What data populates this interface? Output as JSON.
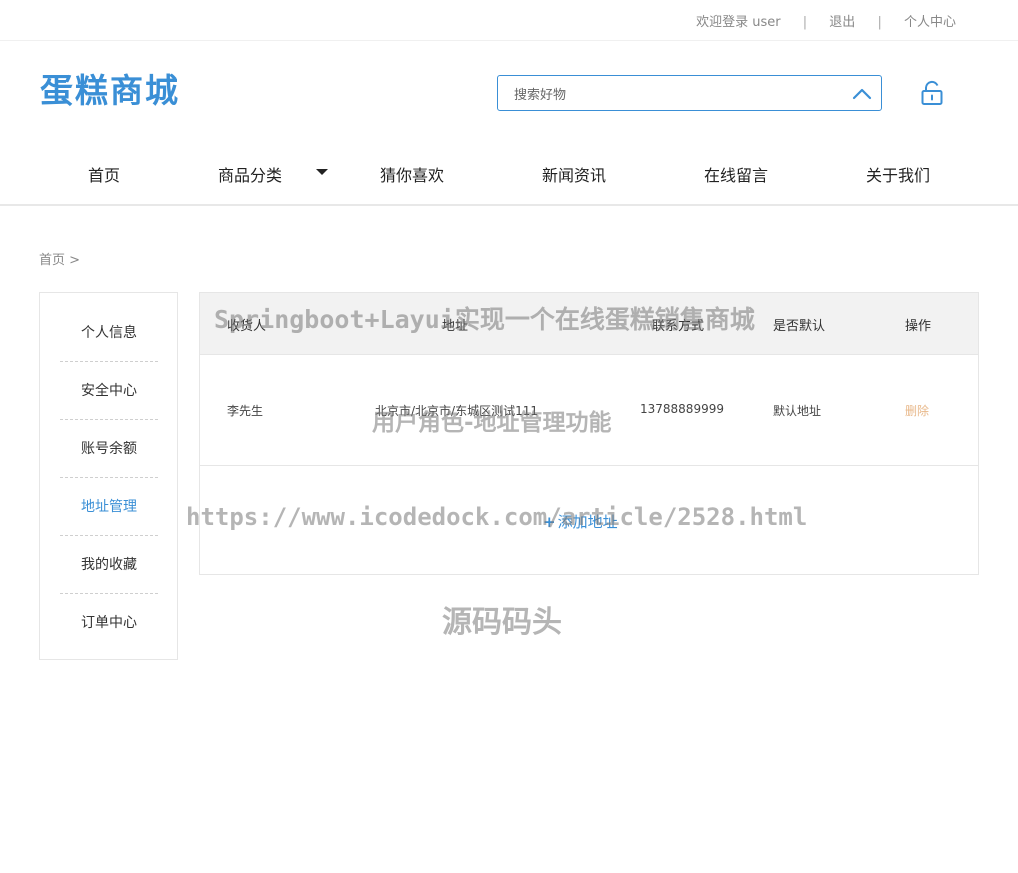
{
  "topbar": {
    "welcome": "欢迎登录 user",
    "logout": "退出",
    "user_center": "个人中心",
    "separator": "|"
  },
  "header": {
    "logo": "蛋糕商城",
    "search_placeholder": "搜索好物",
    "search_icon": "chevron-up-icon",
    "lock_icon": "unlock-icon",
    "accent_color": "#3a8fd6"
  },
  "nav": {
    "items": [
      "首页",
      "商品分类",
      "猜你喜欢",
      "新闻资讯",
      "在线留言",
      "关于我们"
    ]
  },
  "breadcrumb": "首页 >",
  "sidebar": {
    "items": [
      "个人信息",
      "安全中心",
      "账号余额",
      "地址管理",
      "我的收藏",
      "订单中心"
    ],
    "active": "地址管理"
  },
  "address_table": {
    "columns": [
      "收货人",
      "地址",
      "联系方式",
      "是否默认",
      "操作"
    ],
    "rows": [
      {
        "name": "李先生",
        "address": "北京市/北京市/东城区测试111",
        "phone": "13788889999",
        "default": "默认地址",
        "action": "删除"
      }
    ],
    "add_label": "添加地址",
    "add_icon": "plus-icon"
  },
  "watermark": {
    "line1": "Springboot+Layui实现一个在线蛋糕销售商城",
    "line2": "用户角色-地址管理功能",
    "line3": "https://www.icodedock.com/article/2528.html",
    "line4": "源码码头"
  }
}
